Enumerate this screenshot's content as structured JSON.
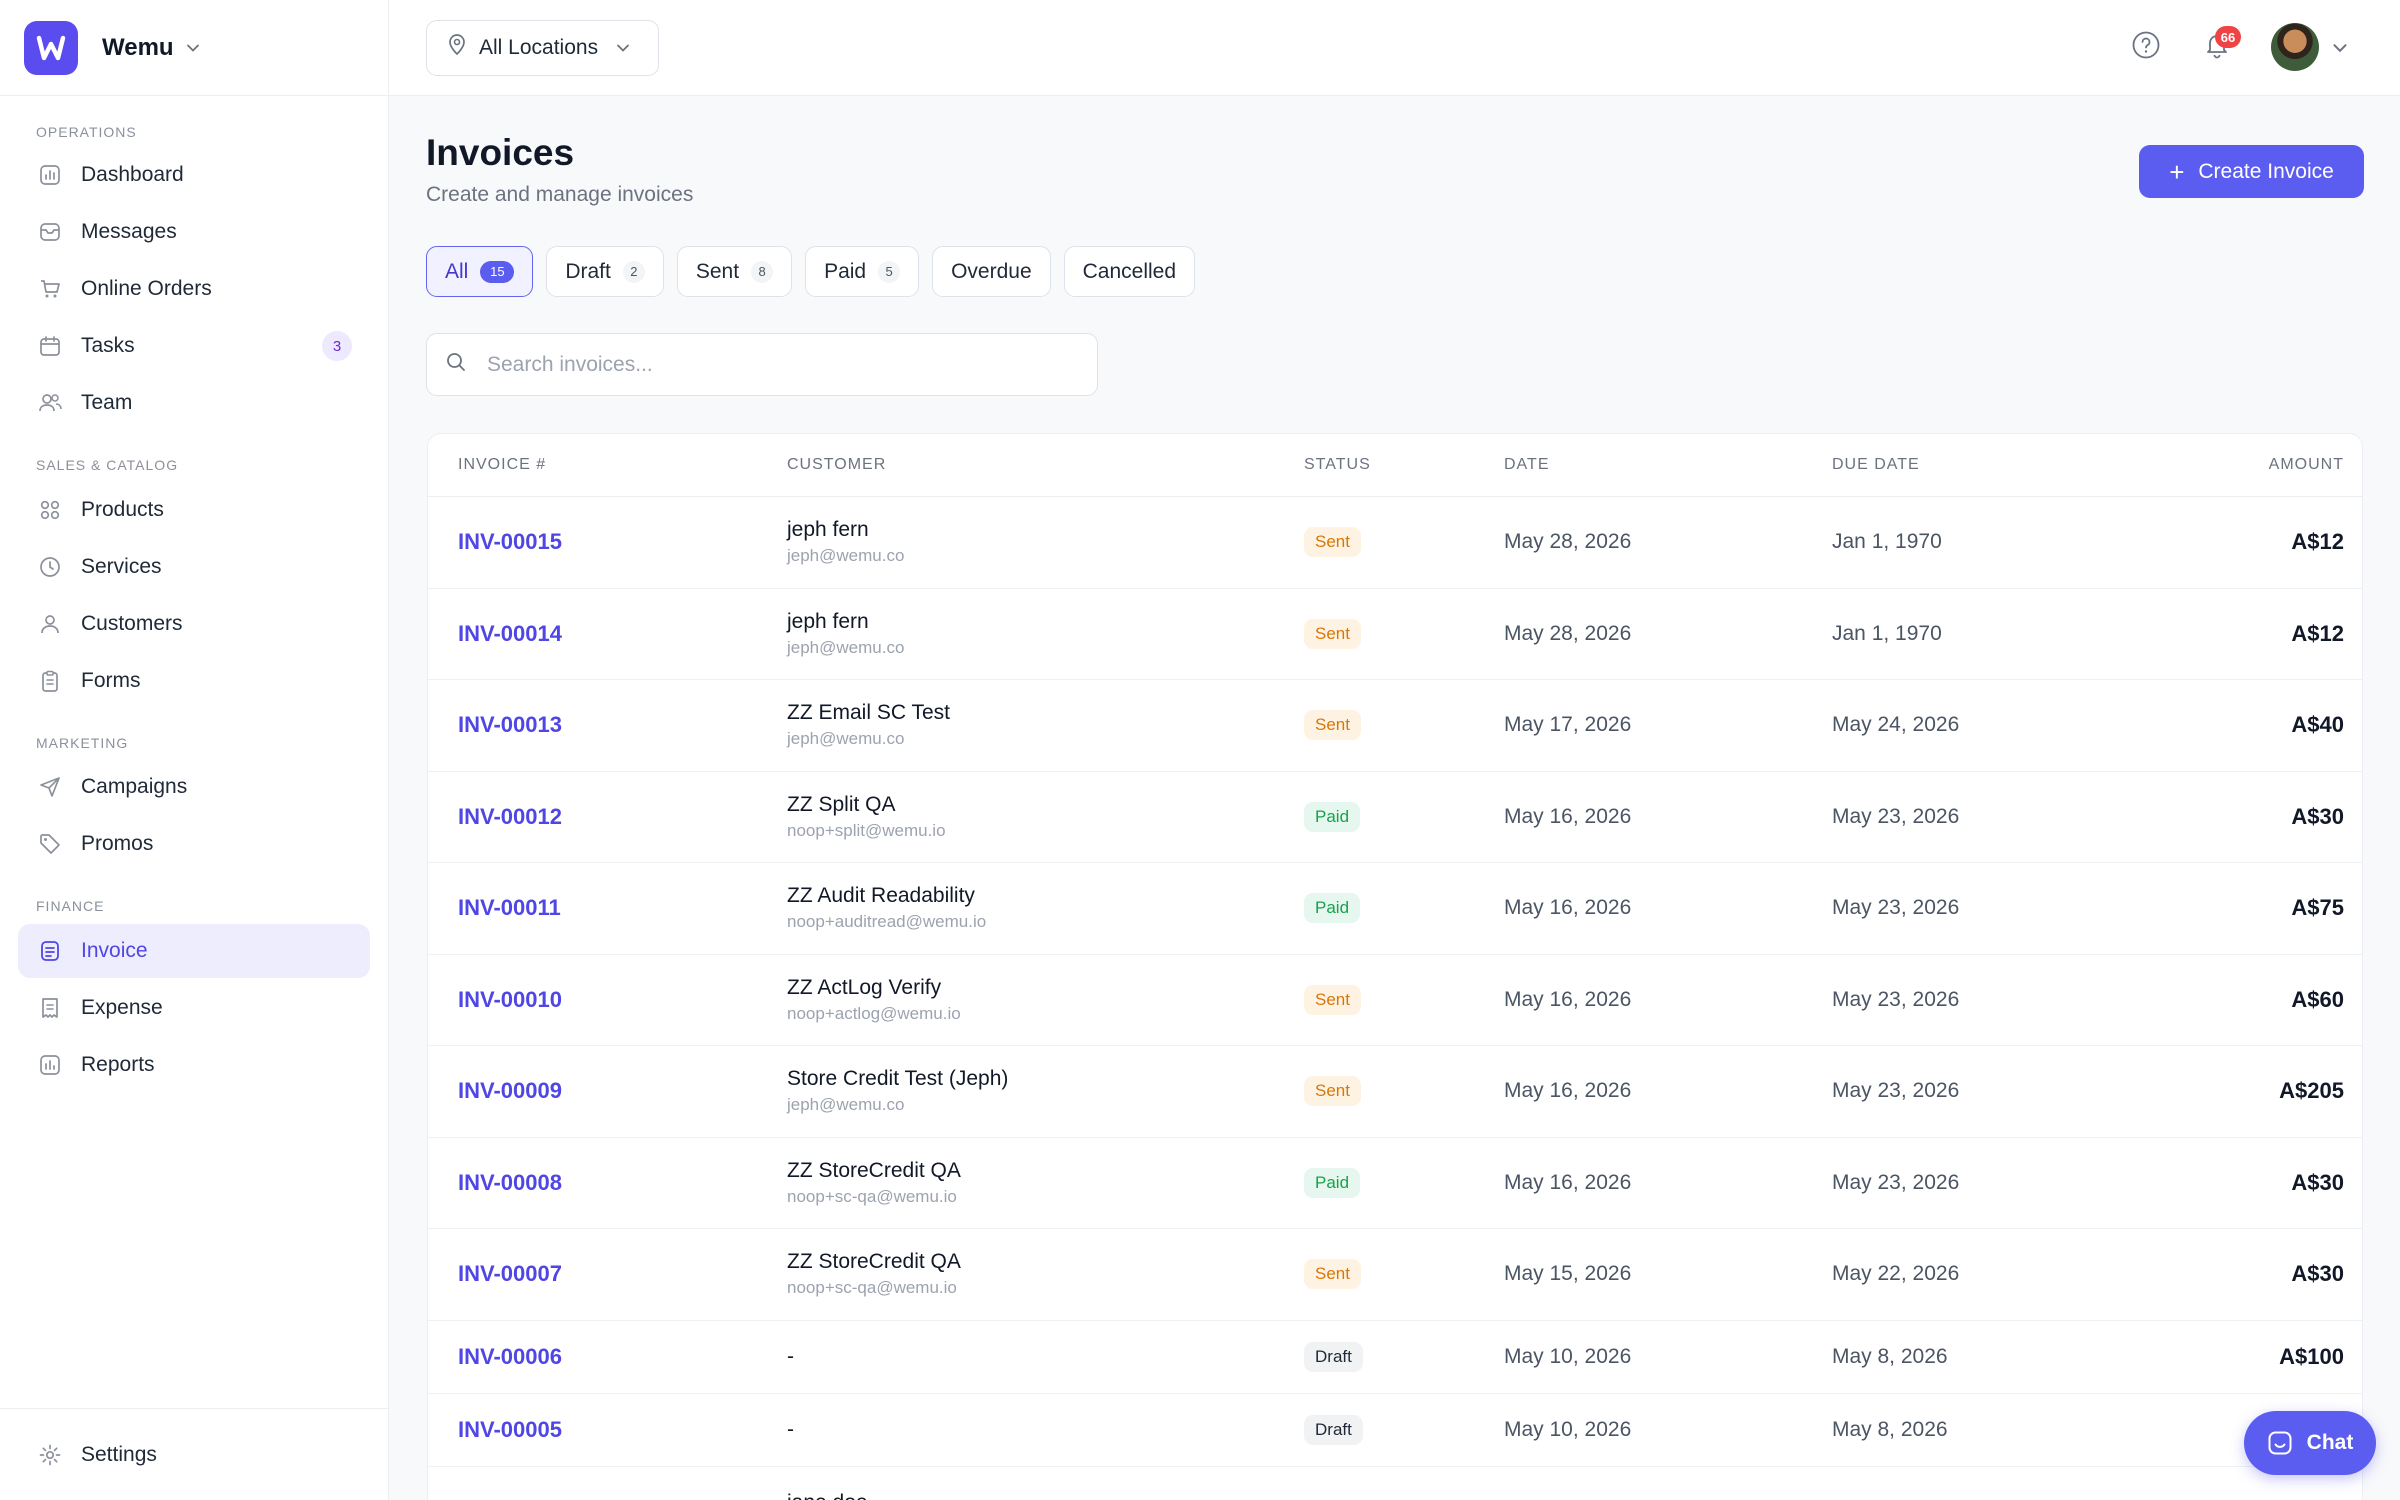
{
  "brand": {
    "name": "Wemu"
  },
  "topbar": {
    "location": "All Locations",
    "notifications": "66"
  },
  "sidebar": {
    "sections": [
      {
        "title": "OPERATIONS",
        "items": [
          {
            "label": "Dashboard",
            "icon": "bar-chart-icon"
          },
          {
            "label": "Messages",
            "icon": "inbox-icon"
          },
          {
            "label": "Online Orders",
            "icon": "cart-icon"
          },
          {
            "label": "Tasks",
            "icon": "calendar-icon",
            "badge": "3"
          },
          {
            "label": "Team",
            "icon": "team-icon"
          }
        ]
      },
      {
        "title": "SALES & CATALOG",
        "items": [
          {
            "label": "Products",
            "icon": "grid-icon"
          },
          {
            "label": "Services",
            "icon": "clock-icon"
          },
          {
            "label": "Customers",
            "icon": "user-icon"
          },
          {
            "label": "Forms",
            "icon": "clipboard-icon"
          }
        ]
      },
      {
        "title": "MARKETING",
        "items": [
          {
            "label": "Campaigns",
            "icon": "send-icon"
          },
          {
            "label": "Promos",
            "icon": "tag-icon"
          }
        ]
      },
      {
        "title": "FINANCE",
        "items": [
          {
            "label": "Invoice",
            "icon": "invoice-icon"
          },
          {
            "label": "Expense",
            "icon": "receipt-icon"
          },
          {
            "label": "Reports",
            "icon": "report-icon"
          }
        ]
      }
    ],
    "settings": "Settings"
  },
  "main": {
    "title": "Invoices",
    "subtitle": "Create and manage invoices",
    "create_label": "Create Invoice",
    "tabs": [
      {
        "label": "All",
        "count": "15"
      },
      {
        "label": "Draft",
        "count": "2"
      },
      {
        "label": "Sent",
        "count": "8"
      },
      {
        "label": "Paid",
        "count": "5"
      },
      {
        "label": "Overdue",
        "count": ""
      },
      {
        "label": "Cancelled",
        "count": ""
      }
    ],
    "search_placeholder": "Search invoices...",
    "columns": [
      "INVOICE #",
      "CUSTOMER",
      "STATUS",
      "DATE",
      "DUE DATE",
      "AMOUNT"
    ],
    "rows": [
      {
        "id": "INV-00015",
        "name": "jeph fern",
        "email": "jeph@wemu.co",
        "status": "Sent",
        "date": "May 28, 2026",
        "due": "Jan 1, 1970",
        "amount": "A$12"
      },
      {
        "id": "INV-00014",
        "name": "jeph fern",
        "email": "jeph@wemu.co",
        "status": "Sent",
        "date": "May 28, 2026",
        "due": "Jan 1, 1970",
        "amount": "A$12"
      },
      {
        "id": "INV-00013",
        "name": "ZZ Email SC Test",
        "email": "jeph@wemu.co",
        "status": "Sent",
        "date": "May 17, 2026",
        "due": "May 24, 2026",
        "amount": "A$40"
      },
      {
        "id": "INV-00012",
        "name": "ZZ Split QA",
        "email": "noop+split@wemu.io",
        "status": "Paid",
        "date": "May 16, 2026",
        "due": "May 23, 2026",
        "amount": "A$30"
      },
      {
        "id": "INV-00011",
        "name": "ZZ Audit Readability",
        "email": "noop+auditread@wemu.io",
        "status": "Paid",
        "date": "May 16, 2026",
        "due": "May 23, 2026",
        "amount": "A$75"
      },
      {
        "id": "INV-00010",
        "name": "ZZ ActLog Verify",
        "email": "noop+actlog@wemu.io",
        "status": "Sent",
        "date": "May 16, 2026",
        "due": "May 23, 2026",
        "amount": "A$60"
      },
      {
        "id": "INV-00009",
        "name": "Store Credit Test (Jeph)",
        "email": "jeph@wemu.co",
        "status": "Sent",
        "date": "May 16, 2026",
        "due": "May 23, 2026",
        "amount": "A$205"
      },
      {
        "id": "INV-00008",
        "name": "ZZ StoreCredit QA",
        "email": "noop+sc-qa@wemu.io",
        "status": "Paid",
        "date": "May 16, 2026",
        "due": "May 23, 2026",
        "amount": "A$30"
      },
      {
        "id": "INV-00007",
        "name": "ZZ StoreCredit QA",
        "email": "noop+sc-qa@wemu.io",
        "status": "Sent",
        "date": "May 15, 2026",
        "due": "May 22, 2026",
        "amount": "A$30"
      },
      {
        "id": "INV-00006",
        "name": "-",
        "email": "",
        "status": "Draft",
        "date": "May 10, 2026",
        "due": "May 8, 2026",
        "amount": "A$100"
      },
      {
        "id": "INV-00005",
        "name": "-",
        "email": "",
        "status": "Draft",
        "date": "May 10, 2026",
        "due": "May 8, 2026",
        "amount": ""
      },
      {
        "id": "",
        "name": "jane doe",
        "email": "",
        "status": "",
        "date": "",
        "due": "",
        "amount": ""
      }
    ],
    "chat_label": "Chat"
  },
  "colors": {
    "accent": "#5b5cf0",
    "sent": "#d97706",
    "paid": "#16a34a",
    "notification": "#ef4444"
  }
}
